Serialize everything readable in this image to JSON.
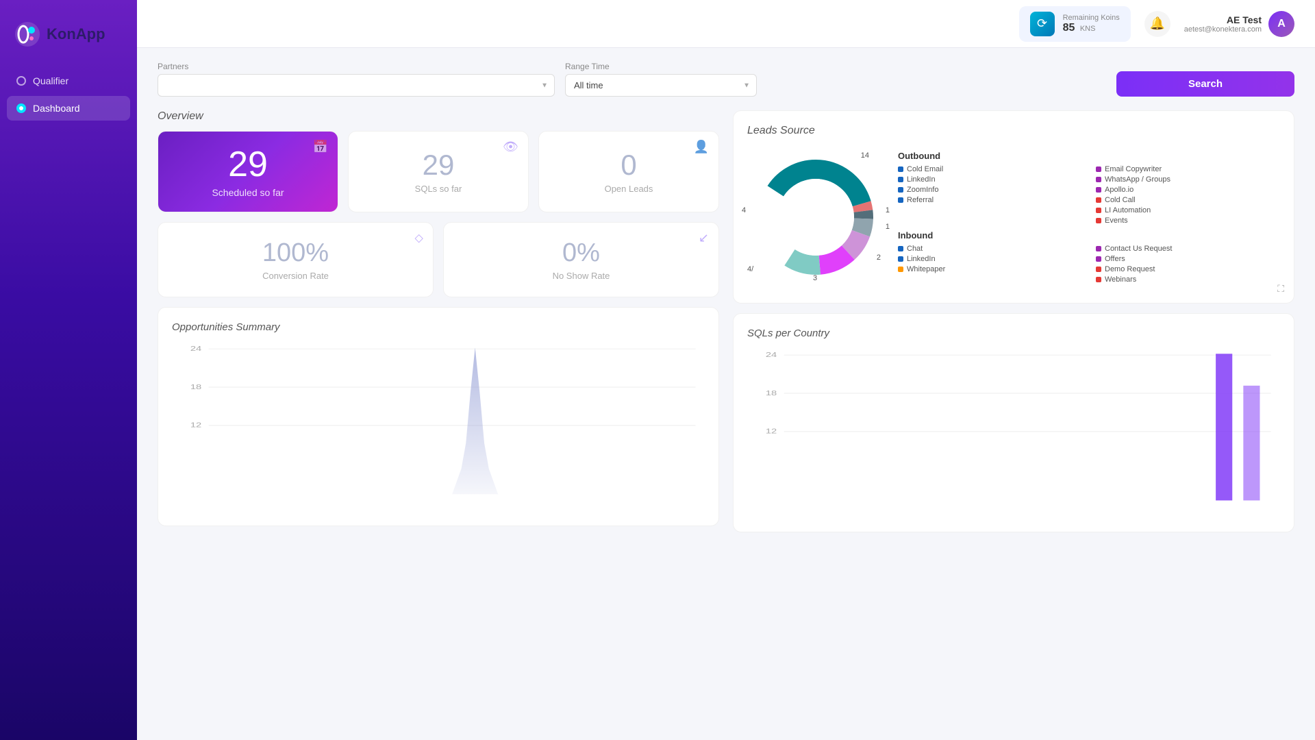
{
  "app": {
    "name": "KonApp"
  },
  "sidebar": {
    "items": [
      {
        "id": "qualifier",
        "label": "Qualifier",
        "active": false
      },
      {
        "id": "dashboard",
        "label": "Dashboard",
        "active": true
      }
    ]
  },
  "topbar": {
    "koins": {
      "label": "Remaining Koins",
      "value": "85",
      "unit": "KNS"
    },
    "user": {
      "name": "AE Test",
      "email": "aetest@konektera.com",
      "initial": "A"
    }
  },
  "filters": {
    "partners_label": "Partners",
    "partners_placeholder": "",
    "range_label": "Range Time",
    "range_value": "All time",
    "search_label": "Search"
  },
  "overview": {
    "title": "Overview",
    "cards": [
      {
        "id": "scheduled",
        "value": "29",
        "label": "Scheduled so far",
        "featured": true,
        "icon": "📅"
      },
      {
        "id": "sqls",
        "value": "29",
        "label": "SQLs so far",
        "featured": false,
        "icon": "👁"
      },
      {
        "id": "open_leads",
        "value": "0",
        "label": "Open Leads",
        "featured": false,
        "icon": "👤"
      },
      {
        "id": "conversion",
        "value": "100%",
        "label": "Conversion Rate",
        "featured": false,
        "icon": "🔽"
      },
      {
        "id": "no_show",
        "value": "0%",
        "label": "No Show Rate",
        "featured": false,
        "icon": "📉"
      }
    ]
  },
  "leads_source": {
    "title": "Leads Source",
    "outbound_title": "Outbound",
    "inbound_title": "Inbound",
    "legend": {
      "outbound": [
        {
          "label": "Cold Email",
          "color": "#1565c0"
        },
        {
          "label": "LinkedIn",
          "color": "#1565c0"
        },
        {
          "label": "ZoomInfo",
          "color": "#1565c0"
        },
        {
          "label": "Referral",
          "color": "#1565c0"
        },
        {
          "label": "Email Copywriter",
          "color": "#9c27b0"
        },
        {
          "label": "WhatsApp / Groups",
          "color": "#9c27b0"
        },
        {
          "label": "Apollo.io",
          "color": "#9c27b0"
        },
        {
          "label": "Cold Call",
          "color": "#e53935"
        },
        {
          "label": "LI Automation",
          "color": "#e53935"
        },
        {
          "label": "Events",
          "color": "#e53935"
        }
      ],
      "inbound": [
        {
          "label": "Chat",
          "color": "#1565c0"
        },
        {
          "label": "LinkedIn",
          "color": "#1565c0"
        },
        {
          "label": "Whitepaper",
          "color": "#ff9800"
        },
        {
          "label": "Contact Us Request",
          "color": "#9c27b0"
        },
        {
          "label": "Offers",
          "color": "#9c27b0"
        },
        {
          "label": "Demo Request",
          "color": "#e53935"
        },
        {
          "label": "Webinars",
          "color": "#e53935"
        }
      ]
    },
    "donut": {
      "segments": [
        {
          "label": "14",
          "color": "#00838f",
          "value": 14
        },
        {
          "label": "1",
          "color": "#e57373",
          "value": 1
        },
        {
          "label": "1",
          "color": "#546e7a",
          "value": 1
        },
        {
          "label": "2",
          "color": "#90a4ae",
          "value": 2
        },
        {
          "label": "3",
          "color": "#ce93d8",
          "value": 3
        },
        {
          "label": "4/",
          "color": "#e040fb",
          "value": 4
        },
        {
          "label": "4",
          "color": "#80cbc4",
          "value": 4
        }
      ]
    }
  },
  "charts": {
    "opportunities": {
      "title": "Opportunities Summary",
      "y_labels": [
        "24",
        "18",
        "12"
      ],
      "color": "#7986cb"
    },
    "sqls_country": {
      "title": "SQLs per Country",
      "y_labels": [
        "24",
        "18",
        "12"
      ],
      "color": "#7986cb"
    }
  }
}
